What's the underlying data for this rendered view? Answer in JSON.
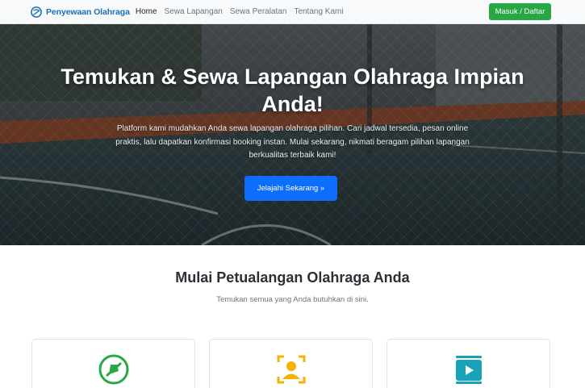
{
  "navbar": {
    "brand": "Penyewaan Olahraga",
    "links": [
      "Home",
      "Sewa Lapangan",
      "Sewa Peralatan",
      "Tentang Kami"
    ],
    "login": "Masuk / Daftar"
  },
  "hero": {
    "title": "Temukan & Sewa Lapangan Olahraga Impian Anda!",
    "description": "Platform kami mudahkan Anda sewa lapangan olahraga pilihan. Cari jadwal tersedia, pesan online praktis, lalu dapatkan konfirmasi booking instan. Mulai sekarang, nikmati beragam pilihan lapangan berkualitas terbaik kami!",
    "cta": "Jelajahi Sekarang »"
  },
  "features": {
    "title": "Mulai Petualangan Olahraga Anda",
    "subtitle": "Temukan semua yang Anda butuhkan di sini.",
    "cards": [
      {
        "icon": "sports-field-icon",
        "color": "#28a745"
      },
      {
        "icon": "user-profile-icon",
        "color": "#f5b300"
      },
      {
        "icon": "video-play-icon",
        "color": "#17a2b8"
      }
    ]
  }
}
